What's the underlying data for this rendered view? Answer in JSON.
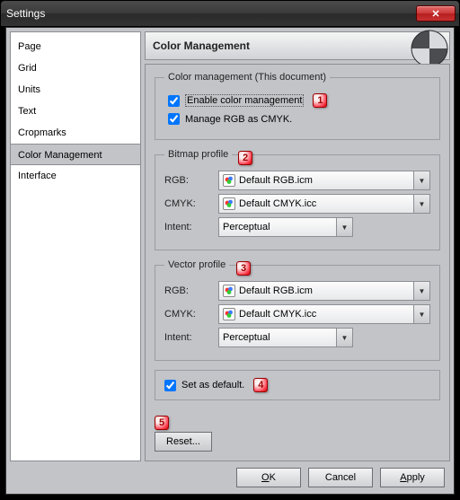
{
  "window": {
    "title": "Settings"
  },
  "sidebar": {
    "items": [
      {
        "label": "Page"
      },
      {
        "label": "Grid"
      },
      {
        "label": "Units"
      },
      {
        "label": "Text"
      },
      {
        "label": "Cropmarks"
      },
      {
        "label": "Color Management"
      },
      {
        "label": "Interface"
      }
    ],
    "selected_index": 5
  },
  "header": {
    "title": "Color Management"
  },
  "groups": {
    "doc": {
      "legend": "Color management (This document)",
      "enable": {
        "label": "Enable color management",
        "checked": true
      },
      "manage_rgb": {
        "label": "Manage RGB as CMYK.",
        "checked": true
      }
    },
    "bitmap": {
      "legend": "Bitmap profile",
      "rgb_label": "RGB:",
      "rgb_value": "Default RGB.icm",
      "cmyk_label": "CMYK:",
      "cmyk_value": "Default CMYK.icc",
      "intent_label": "Intent:",
      "intent_value": "Perceptual"
    },
    "vector": {
      "legend": "Vector profile",
      "rgb_label": "RGB:",
      "rgb_value": "Default RGB.icm",
      "cmyk_label": "CMYK:",
      "cmyk_value": "Default CMYK.icc",
      "intent_label": "Intent:",
      "intent_value": "Perceptual"
    }
  },
  "set_default": {
    "label": "Set as default.",
    "checked": true
  },
  "reset": {
    "label": "Reset..."
  },
  "buttons": {
    "ok": "OK",
    "ok_mn": "O",
    "ok_rest": "K",
    "cancel": "Cancel",
    "apply": "Apply",
    "apply_mn": "A",
    "apply_rest": "pply"
  },
  "callouts": {
    "c1": "1",
    "c2": "2",
    "c3": "3",
    "c4": "4",
    "c5": "5"
  }
}
